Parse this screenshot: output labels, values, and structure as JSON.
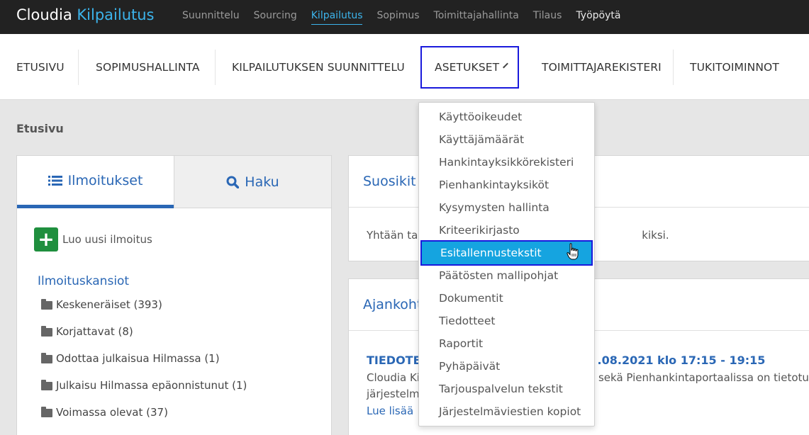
{
  "brand": {
    "name": "Cloudia",
    "product": "Kilpailutus"
  },
  "topnav": [
    "Suunnittelu",
    "Sourcing",
    "Kilpailutus",
    "Sopimus",
    "Toimittajahallinta",
    "Tilaus",
    "Työpöytä"
  ],
  "mainnav": {
    "etusivu": "ETUSIVU",
    "sopimushallinta": "SOPIMUSHALLINTA",
    "suunnittelu": "KILPAILUTUKSEN SUUNNITTELU",
    "asetukset": "ASETUKSET",
    "toimittajarekisteri": "TOIMITTAJAREKISTERI",
    "tukitoiminnot": "TUKITOIMINNOT"
  },
  "breadcrumb": "Etusivu",
  "left": {
    "tab_notices": "Ilmoitukset",
    "tab_search": "Haku",
    "new_notice": "Luo uusi ilmoitus",
    "folders_title": "Ilmoituskansiot",
    "folders": [
      "Keskeneräiset (393)",
      "Korjattavat (8)",
      "Odottaa julkaisua Hilmassa (1)",
      "Julkaisu Hilmassa epäonnistunut (1)",
      "Voimassa olevat (37)"
    ]
  },
  "favorites": {
    "title": "Suosikit",
    "text_left": "Yhtään ta",
    "text_right": "kiksi."
  },
  "current": {
    "title": "Ajankoht",
    "news_title_left": "TIEDOTE",
    "news_title_right": ".08.2021 klo 17:15 - 19:15",
    "line1_left": "Cloudia Ki",
    "line1_right": "sekä Pienhankintaportaalissa on tietotur",
    "line2_left": "järjestelm",
    "read_more": "Lue lisää"
  },
  "dropdown": {
    "items": [
      "Käyttöoikeudet",
      "Käyttäjämäärät",
      "Hankintayksikkörekisteri",
      "Pienhankintayksiköt",
      "Kysymysten hallinta",
      "Kriteerikirjasto",
      "Esitallennustekstit",
      "Päätösten mallipohjat",
      "Dokumentit",
      "Tiedotteet",
      "Raportit",
      "Pyhäpäivät",
      "Tarjouspalvelun tekstit",
      "Järjestelmäviestien kopiot"
    ],
    "highlighted_index": 6
  },
  "colors": {
    "accent": "#3cb4ec",
    "link": "#2a67b5",
    "highlight": "#15a4e0",
    "focus": "#1a1adc",
    "add": "#1f8f3e"
  }
}
